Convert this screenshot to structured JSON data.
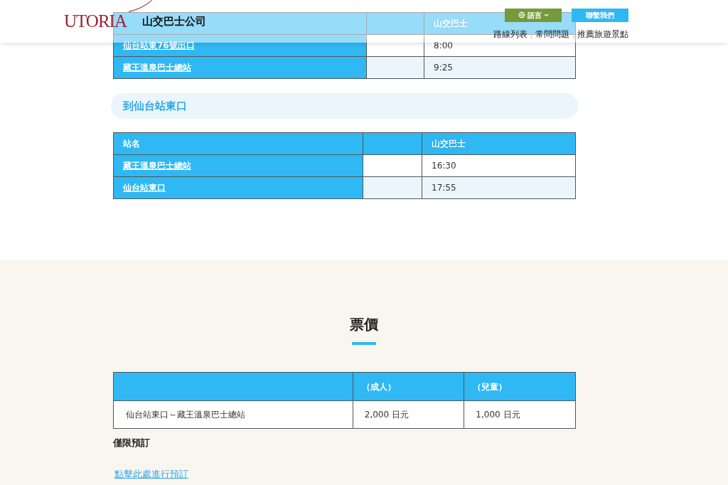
{
  "header": {
    "logo": "UTORIA",
    "company": "山交巴士公司",
    "language_button": "語言",
    "contact_button": "聯繫我們",
    "nav": [
      "路線列表",
      "常問問題",
      "推薦旅遊景點"
    ]
  },
  "outbound_table": {
    "time_header": "山交巴士",
    "rows": [
      {
        "station": "仙台站東76號出口",
        "time": "8:00"
      },
      {
        "station": "藏王溫泉巴士總站",
        "time": "9:25"
      }
    ]
  },
  "inbound": {
    "heading": "到仙台站東口",
    "station_header": "站名",
    "time_header": "山交巴士",
    "rows": [
      {
        "station": "藏王溫泉巴士總站",
        "time": "16:30"
      },
      {
        "station": "仙台站東口",
        "time": "17:55"
      }
    ]
  },
  "fares": {
    "title": "票價",
    "columns": [
      "（成人）",
      "（兒童）"
    ],
    "rows": [
      {
        "route": "仙台站東口～藏王溫泉巴士總站",
        "adult": "2,000 日元",
        "child": "1,000 日元"
      }
    ],
    "note": "僅限預訂",
    "link": "點擊此處進行預訂"
  }
}
